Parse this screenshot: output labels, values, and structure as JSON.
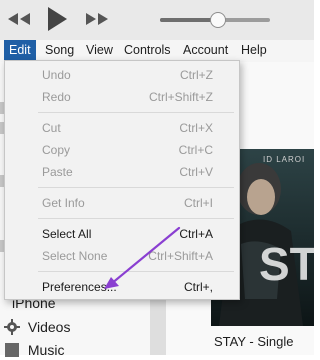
{
  "menubar": {
    "items": [
      {
        "label": "Edit"
      },
      {
        "label": "Song"
      },
      {
        "label": "View"
      },
      {
        "label": "Controls"
      },
      {
        "label": "Account"
      },
      {
        "label": "Help"
      }
    ]
  },
  "player": {
    "volume_level": 0.52
  },
  "edit_menu": {
    "items": [
      {
        "label": "Undo",
        "shortcut": "Ctrl+Z",
        "enabled": false
      },
      {
        "label": "Redo",
        "shortcut": "Ctrl+Shift+Z",
        "enabled": false
      },
      {
        "label": "Cut",
        "shortcut": "Ctrl+X",
        "enabled": false
      },
      {
        "label": "Copy",
        "shortcut": "Ctrl+C",
        "enabled": false
      },
      {
        "label": "Paste",
        "shortcut": "Ctrl+V",
        "enabled": false
      },
      {
        "label": "Get Info",
        "shortcut": "Ctrl+I",
        "enabled": false
      },
      {
        "label": "Select All",
        "shortcut": "Ctrl+A",
        "enabled": true
      },
      {
        "label": "Select None",
        "shortcut": "Ctrl+Shift+A",
        "enabled": false
      },
      {
        "label": "Preferences...",
        "shortcut": "Ctrl+,",
        "enabled": true
      }
    ]
  },
  "sidebar": {
    "items": [
      {
        "label": "iPhone",
        "icon": "iphone-icon"
      },
      {
        "label": "Videos",
        "icon": "gear-icon"
      },
      {
        "label": "Music",
        "icon": "music-icon"
      }
    ]
  },
  "album": {
    "title": "STAY - Single",
    "art_text": "STAY",
    "art_small_text": "ID LAROI"
  },
  "colors": {
    "menu_highlight": "#1f5fa6",
    "annotation_arrow": "#8a3fd1"
  }
}
